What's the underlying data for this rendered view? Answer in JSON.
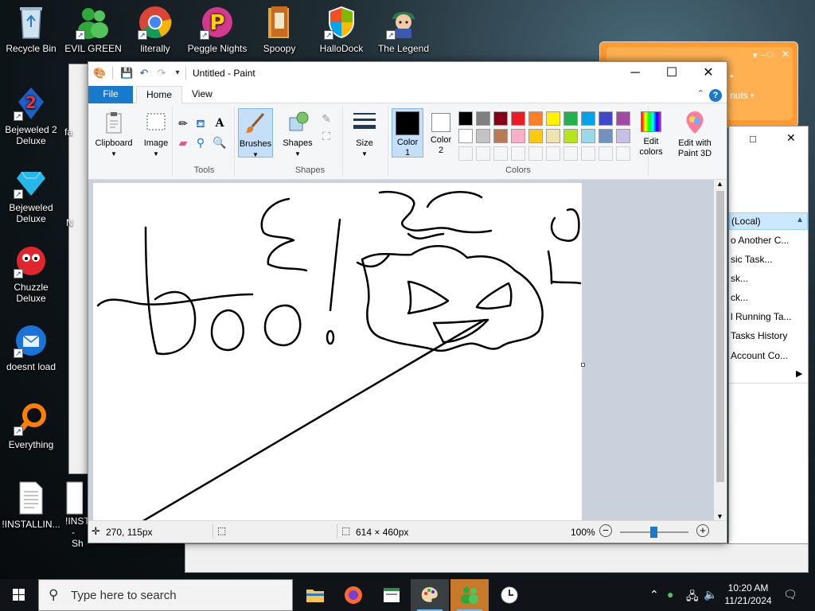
{
  "desktop": {
    "top_icons": [
      {
        "label": "Recycle Bin",
        "icon": "recycle-bin-icon"
      },
      {
        "label": "EVIL GREEN",
        "icon": "buddy-icon"
      },
      {
        "label": "literally",
        "icon": "chrome-icon"
      },
      {
        "label": "Peggle Nights",
        "icon": "peggle-icon"
      },
      {
        "label": "Spoopy",
        "icon": "folder-icon"
      },
      {
        "label": "HalloDock",
        "icon": "shield-icon"
      },
      {
        "label": "The Legend",
        "icon": "game-character-icon"
      }
    ],
    "left_icons": [
      {
        "label_line1": "Bejeweled 2",
        "label_line2": "Deluxe",
        "icon": "bejeweled2-icon"
      },
      {
        "label_line1": "Bejeweled",
        "label_line2": "Deluxe",
        "icon": "bejeweled-icon"
      },
      {
        "label_line1": "Chuzzle",
        "label_line2": "Deluxe",
        "icon": "chuzzle-icon"
      },
      {
        "label_line1": "doesnt load",
        "label_line2": "",
        "icon": "thunderbird-icon"
      },
      {
        "label_line1": "Everything",
        "label_line2": "",
        "icon": "everything-icon"
      },
      {
        "label_line1": "!INSTALLIN...",
        "label_line2": "",
        "icon": "document-icon"
      }
    ],
    "partial_labels": {
      "install2_line1": "!INST",
      "install2_line2": "- Sh",
      "fa": "fa",
      "n": "N"
    }
  },
  "background_windows": {
    "orange_chat": {
      "line1": "•",
      "line2": "nuts •"
    },
    "services": {
      "header": "(Local)",
      "items": [
        "o Another C...",
        "sic Task...",
        "sk...",
        "ck...",
        "l Running Ta...",
        "Tasks History",
        "Account Co..."
      ]
    }
  },
  "paint": {
    "title": "Untitled - Paint",
    "tabs": {
      "file": "File",
      "home": "Home",
      "view": "View"
    },
    "ribbon": {
      "clipboard": "Clipboard",
      "image": "Image",
      "tools": "Tools",
      "brushes": "Brushes",
      "shapes_btn": "Shapes",
      "shapes_group": "Shapes",
      "size": "Size",
      "color1_line1": "Color",
      "color1_line2": "1",
      "color2_line1": "Color",
      "color2_line2": "2",
      "colors_group": "Colors",
      "edit_colors_line1": "Edit",
      "edit_colors_line2": "colors",
      "edit_paint3d_line1": "Edit with",
      "edit_paint3d_line2": "Paint 3D"
    },
    "colors": {
      "color1": "#000000",
      "color2": "#ffffff",
      "palette_row1": [
        "#000000",
        "#7f7f7f",
        "#880015",
        "#ed1c24",
        "#ff7f27",
        "#fff200",
        "#22b14c",
        "#00a2e8",
        "#3f48cc",
        "#a349a4"
      ],
      "palette_row2": [
        "#ffffff",
        "#c3c3c3",
        "#b97a57",
        "#ffaec9",
        "#ffc90e",
        "#efe4b0",
        "#b5e61d",
        "#99d9ea",
        "#7092be",
        "#c8bfe7"
      ],
      "palette_row3": [
        "#f5f6f7",
        "#f5f6f7",
        "#f5f6f7",
        "#f5f6f7",
        "#f5f6f7",
        "#f5f6f7",
        "#f5f6f7",
        "#f5f6f7",
        "#f5f6f7",
        "#f5f6f7"
      ]
    },
    "canvas": {
      "drawing": "freehand black scribbles: a smiley face, a long diagonal line, hand-drawn 'boo' text"
    },
    "status": {
      "cursor_pos": "270, 115px",
      "canvas_size": "614 × 460px",
      "zoom": "100%"
    }
  },
  "taskbar": {
    "search_placeholder": "Type here to search",
    "time": "10:20 AM",
    "date": "11/21/2024"
  }
}
